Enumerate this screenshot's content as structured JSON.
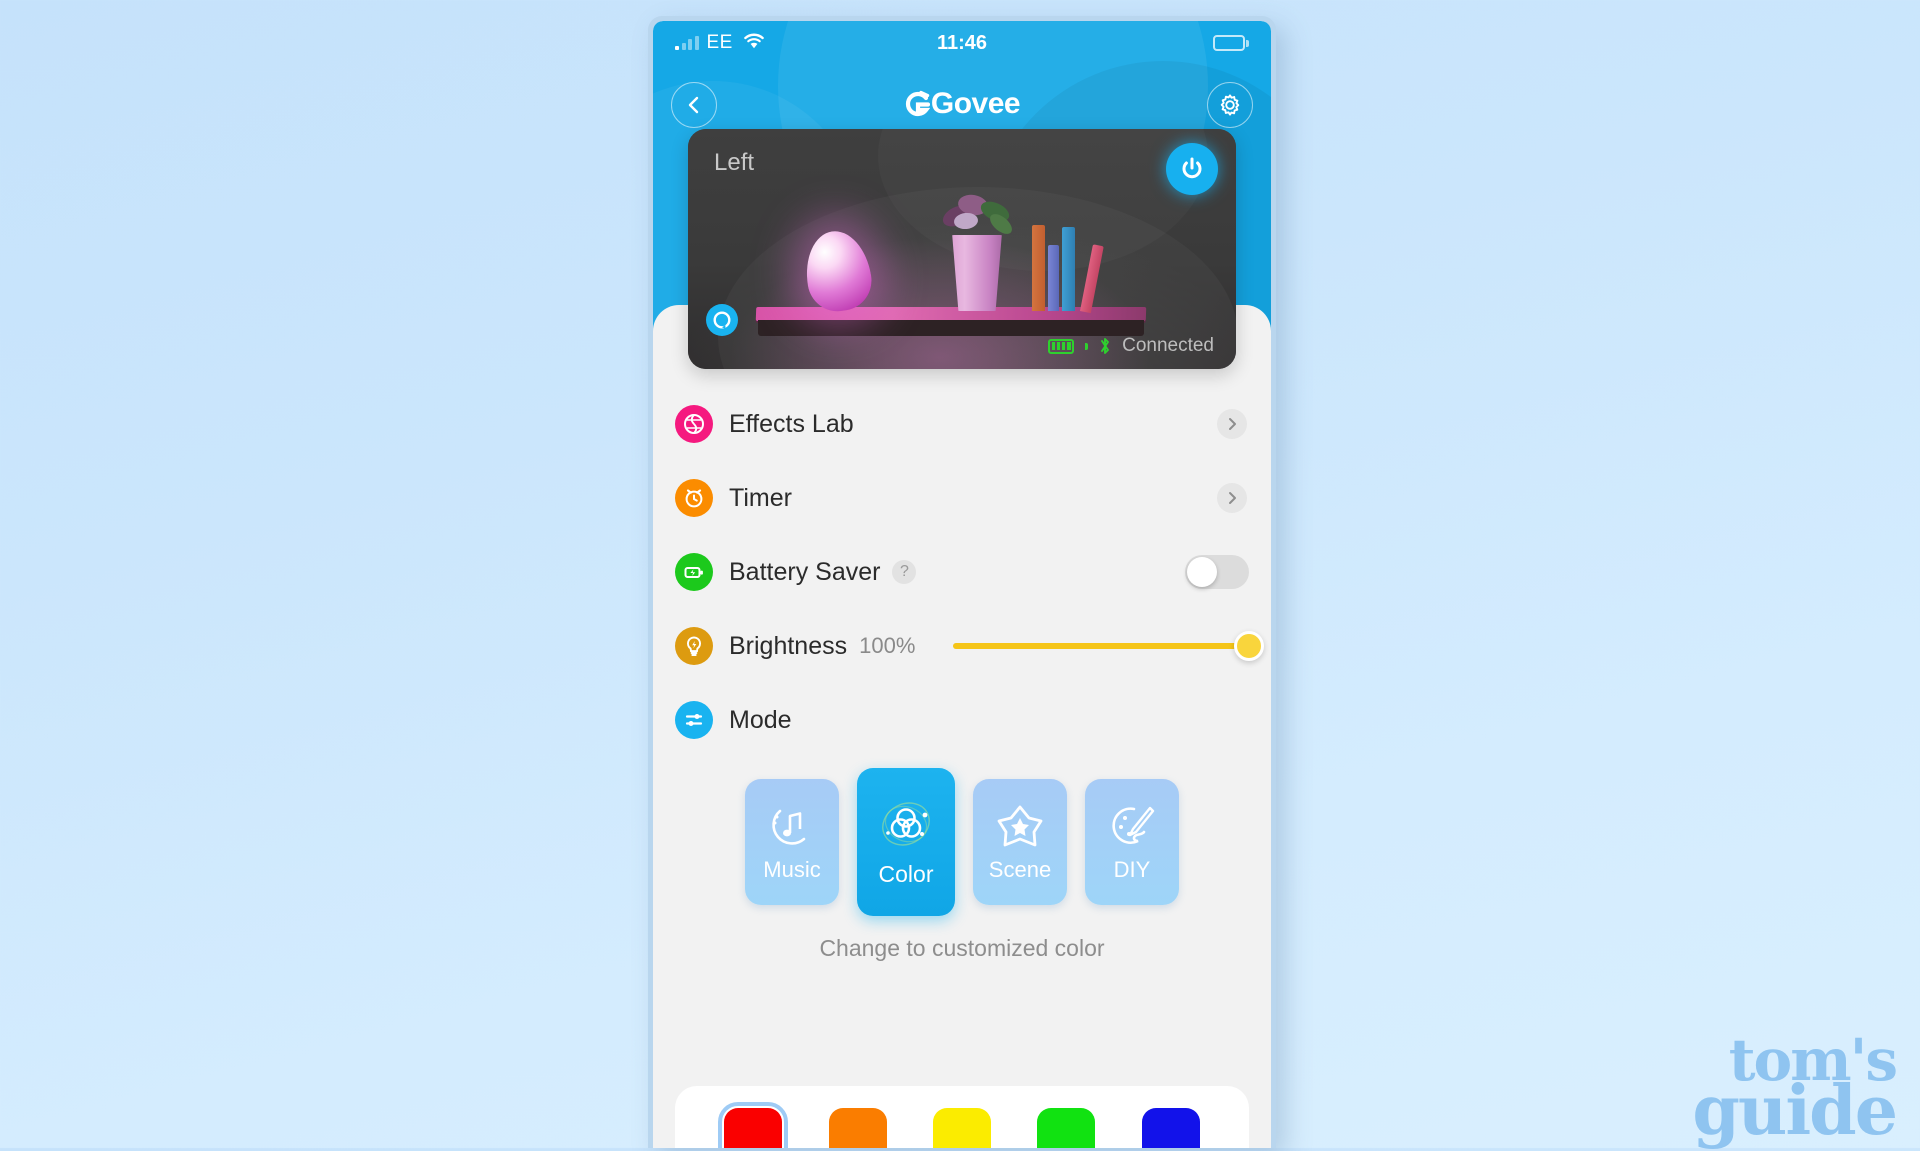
{
  "status_bar": {
    "carrier": "EE",
    "time": "11:46",
    "signal_icon": "cellular-signal-icon",
    "wifi_icon": "wifi-icon",
    "battery_icon": "battery-icon"
  },
  "nav": {
    "back_icon": "chevron-left-icon",
    "title": "Govee",
    "settings_icon": "gear-icon"
  },
  "device_card": {
    "name": "Left",
    "power_icon": "power-button-icon",
    "alexa_icon": "alexa-icon",
    "battery_icon": "battery-full-icon",
    "bluetooth_icon": "bluetooth-icon",
    "connection_status": "Connected"
  },
  "rows": [
    {
      "label": "Effects Lab",
      "icon": "effects-lab-globe-icon",
      "icon_color": "#f5197f",
      "control": "chevron",
      "chevron_icon": "chevron-right-icon"
    },
    {
      "label": "Timer",
      "icon": "alarm-clock-icon",
      "icon_color": "#fb8c00",
      "control": "chevron",
      "chevron_icon": "chevron-right-icon"
    },
    {
      "label": "Battery Saver",
      "icon": "battery-charging-icon",
      "icon_color": "#1cc91c",
      "control": "toggle",
      "toggle_state": "off",
      "help_badge": "?"
    },
    {
      "label": "Brightness",
      "value": "100%",
      "icon": "brightness-bulb-icon",
      "icon_color": "#dd9b10",
      "control": "slider",
      "slider_percent": 100,
      "slider_color": "#f5c518"
    },
    {
      "label": "Mode",
      "icon": "mode-sliders-icon",
      "icon_color": "#19b3f0",
      "control": "none"
    }
  ],
  "modes": [
    {
      "label": "Music",
      "icon": "music-note-icon",
      "active": false
    },
    {
      "label": "Color",
      "icon": "color-circles-icon",
      "active": true
    },
    {
      "label": "Scene",
      "icon": "star-scene-icon",
      "active": false
    },
    {
      "label": "DIY",
      "icon": "paintbrush-palette-icon",
      "active": false
    }
  ],
  "helper_text": "Change to customized color",
  "swatches": [
    {
      "name": "red",
      "color": "#fa0000",
      "selected": true
    },
    {
      "name": "orange",
      "color": "#fa7d00",
      "selected": false
    },
    {
      "name": "yellow",
      "color": "#fbec00",
      "selected": false
    },
    {
      "name": "green",
      "color": "#11e211",
      "selected": false
    },
    {
      "name": "blue",
      "color": "#1212ea",
      "selected": false
    }
  ],
  "watermark": {
    "line1": "tom's",
    "line2": "guide"
  }
}
